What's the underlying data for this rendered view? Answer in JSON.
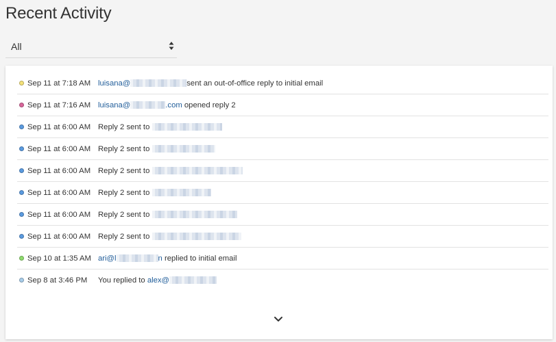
{
  "page": {
    "title": "Recent Activity"
  },
  "filter": {
    "selected": "All",
    "icon": "sort-arrows-icon"
  },
  "activity": {
    "items": [
      {
        "dot_color": "#f5e27a",
        "time": "Sep 11 at 7:18 AM",
        "link": "luisana@",
        "redacted": true,
        "tail": "sent an out-of-office reply to initial email"
      },
      {
        "dot_color": "#d9669b",
        "time": "Sep 11 at 7:16 AM",
        "link": "luisana@",
        "redacted": true,
        "link_suffix": ".com",
        "tail": " opened reply 2"
      },
      {
        "dot_color": "#5b9be0",
        "time": "Sep 11 at 6:00 AM",
        "prefix": "Reply 2 sent to ",
        "redacted": true
      },
      {
        "dot_color": "#5b9be0",
        "time": "Sep 11 at 6:00 AM",
        "prefix": "Reply 2 sent to ",
        "redacted": true
      },
      {
        "dot_color": "#5b9be0",
        "time": "Sep 11 at 6:00 AM",
        "prefix": "Reply 2 sent to ",
        "redacted": true
      },
      {
        "dot_color": "#5b9be0",
        "time": "Sep 11 at 6:00 AM",
        "prefix": "Reply 2 sent to ",
        "redacted": true
      },
      {
        "dot_color": "#5b9be0",
        "time": "Sep 11 at 6:00 AM",
        "prefix": "Reply 2 sent to ",
        "redacted": true
      },
      {
        "dot_color": "#5b9be0",
        "time": "Sep 11 at 6:00 AM",
        "prefix": "Reply 2 sent to ",
        "redacted": true
      },
      {
        "dot_color": "#8fdc6e",
        "time": "Sep 10 at 1:35 AM",
        "link": "ari@l",
        "redacted": true,
        "link_suffix": "n",
        "tail": " replied to initial email"
      },
      {
        "dot_color": "#a8cdea",
        "time": "Sep 8 at 3:46 PM",
        "prefix": "You replied to ",
        "link": "alex@",
        "redacted": true
      }
    ]
  },
  "expand": {
    "icon": "chevron-down-icon"
  }
}
